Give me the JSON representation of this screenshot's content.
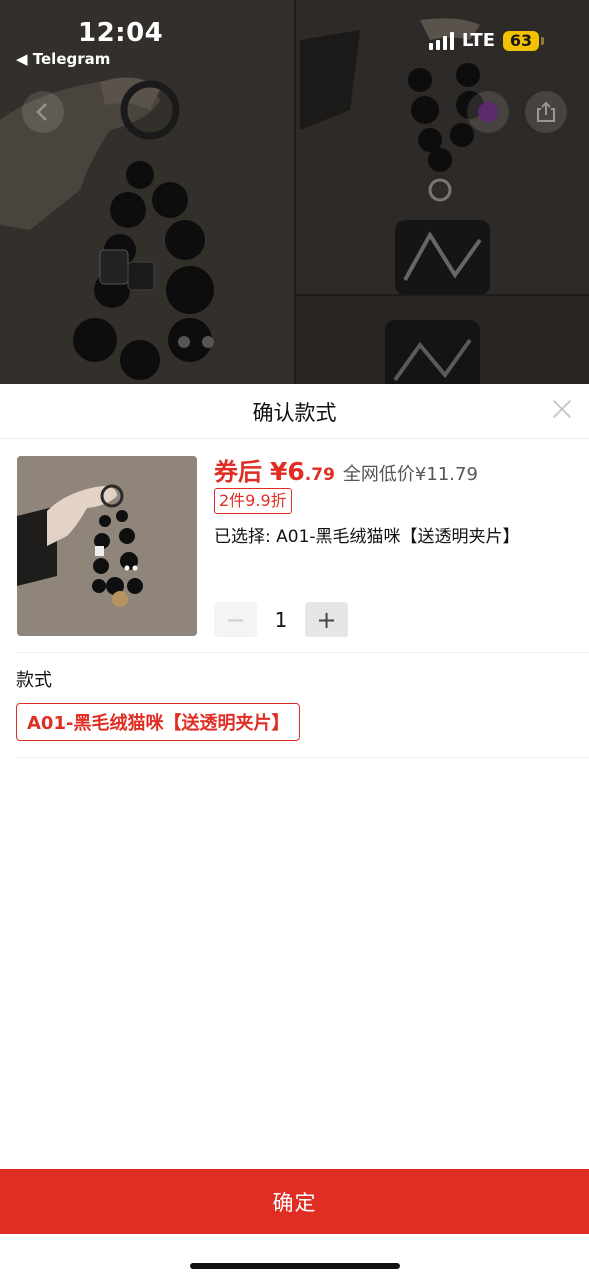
{
  "status_bar": {
    "time": "12:04",
    "back_app": "◀ Telegram",
    "network": "LTE",
    "battery": "63"
  },
  "hero": {
    "back_icon": "chevron-left-icon",
    "share_icon": "share-icon"
  },
  "sheet": {
    "title": "确认款式",
    "close_icon": "close-icon"
  },
  "product": {
    "price_prefix": "券后",
    "price_main": "¥6",
    "price_decimal": ".79",
    "reference_price": "全网低价¥11.79",
    "promo_tag": "2件9.9折",
    "selected_text": "已选择: A01-黑毛绒猫咪【送透明夹片】"
  },
  "quantity": {
    "minus_label": "−",
    "value": "1",
    "plus_label": "+"
  },
  "spec": {
    "label": "款式",
    "options": [
      {
        "label": "A01-黑毛绒猫咪【送透明夹片】",
        "selected": true
      }
    ]
  },
  "footer": {
    "confirm_label": "确定"
  },
  "colors": {
    "accent": "#e02e24",
    "battery": "#f2c200"
  }
}
